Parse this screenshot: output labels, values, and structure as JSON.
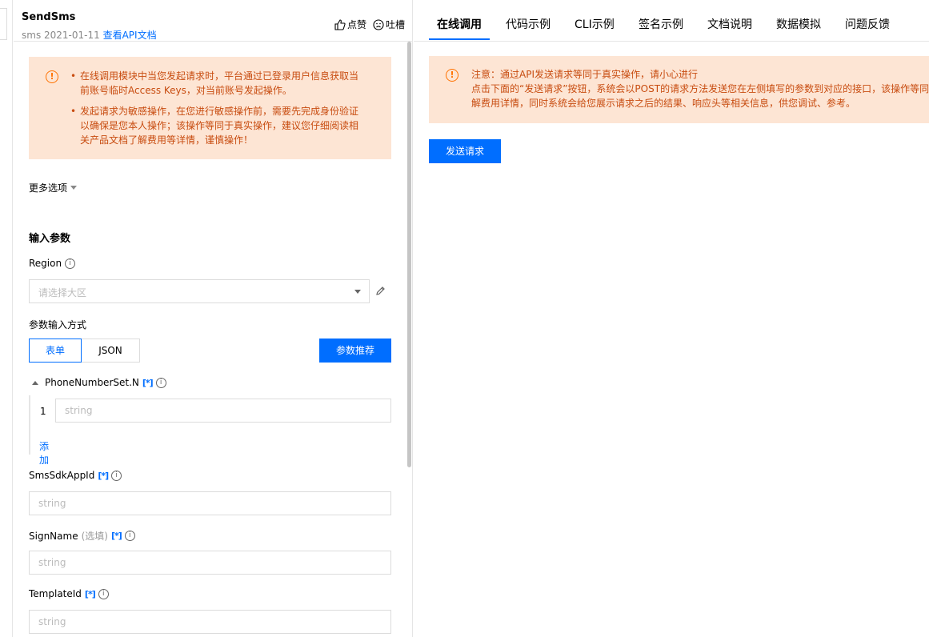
{
  "header": {
    "api_name": "SendSms",
    "api_meta": "sms 2021-01-11",
    "doc_link": "查看API文档",
    "like_label": "点赞",
    "complain_label": "吐槽"
  },
  "left_warning": {
    "items": [
      "在线调用模块中当您发起请求时，平台通过已登录用户信息获取当前账号临时Access Keys，对当前账号发起操作。",
      "发起请求为敏感操作，在您进行敏感操作前，需要先完成身份验证以确保是您本人操作；该操作等同于真实操作，建议您仔细阅读相关产品文档了解费用等详情，谨慎操作！"
    ]
  },
  "more_options": "更多选项",
  "input_section": {
    "title": "输入参数",
    "region": {
      "label": "Region",
      "placeholder": "请选择大区"
    },
    "input_mode": {
      "label": "参数输入方式",
      "options": [
        "表单",
        "JSON"
      ],
      "selected": "表单",
      "recommend_button": "参数推荐"
    },
    "phone_number_set": {
      "label": "PhoneNumberSet.N",
      "required_mark": "[*]",
      "row_index": "1",
      "placeholder": "string",
      "add_label": "添加"
    },
    "sms_sdk_app_id": {
      "label": "SmsSdkAppId",
      "required_mark": "[*]",
      "placeholder": "string"
    },
    "sign_name": {
      "label": "SignName",
      "optional_text": "(选填)",
      "required_mark": "[*]",
      "placeholder": "string"
    },
    "template_id": {
      "label": "TemplateId",
      "required_mark": "[*]",
      "placeholder": "string"
    }
  },
  "right_tabs": [
    {
      "label": "在线调用",
      "active": true
    },
    {
      "label": "代码示例",
      "active": false
    },
    {
      "label": "CLI示例",
      "active": false
    },
    {
      "label": "签名示例",
      "active": false
    },
    {
      "label": "文档说明",
      "active": false
    },
    {
      "label": "数据模拟",
      "active": false
    },
    {
      "label": "问题反馈",
      "active": false
    }
  ],
  "right_notice": {
    "line1": "注意：通过API发送请求等同于真实操作，请小心进行",
    "line2": "点击下面的“发送请求”按钮，系统会以POST的请求方法发送您在左侧填写的参数到对应的接口，该操作等同于真实操作，请谨慎操作，并参阅相关产品文档了",
    "line3": "解费用详情，同时系统会给您展示请求之后的结果、响应头等相关信息，供您调试、参考。"
  },
  "send_button": "发送请求",
  "colors": {
    "accent": "#006eff",
    "warning_bg": "#fde5d4",
    "warning_text": "#c84c10",
    "warning_icon": "#ff7200"
  }
}
